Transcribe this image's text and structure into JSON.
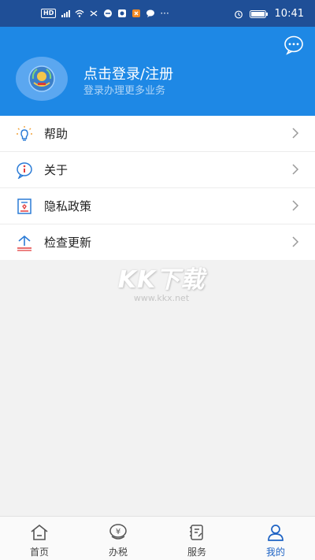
{
  "status_bar": {
    "left_badge": "HD",
    "time": "10:41",
    "icons": [
      "hd-icon",
      "signal-icon",
      "wifi-icon",
      "app-notification-icons",
      "more-dots-icon",
      "alarm-icon",
      "battery-icon"
    ]
  },
  "header": {
    "login_title": "点击登录/注册",
    "login_subtitle": "登录办理更多业务",
    "avatar_icon": "tax-emblem-icon",
    "message_icon": "chat-bubble-icon",
    "background_color": "#1e88e5"
  },
  "menu": {
    "items": [
      {
        "label": "帮助",
        "icon": "lightbulb-icon"
      },
      {
        "label": "关于",
        "icon": "info-icon"
      },
      {
        "label": "隐私政策",
        "icon": "privacy-policy-icon"
      },
      {
        "label": "检查更新",
        "icon": "update-icon"
      }
    ]
  },
  "watermark": {
    "big": "KK下载",
    "small": "www.kkx.net"
  },
  "bottom_nav": {
    "items": [
      {
        "label": "首页",
        "icon": "home-icon",
        "active": false
      },
      {
        "label": "办税",
        "icon": "yuan-coin-icon",
        "active": false
      },
      {
        "label": "服务",
        "icon": "service-icon",
        "active": false
      },
      {
        "label": "我的",
        "icon": "user-icon",
        "active": true
      }
    ],
    "active_color": "#1e63c4"
  }
}
